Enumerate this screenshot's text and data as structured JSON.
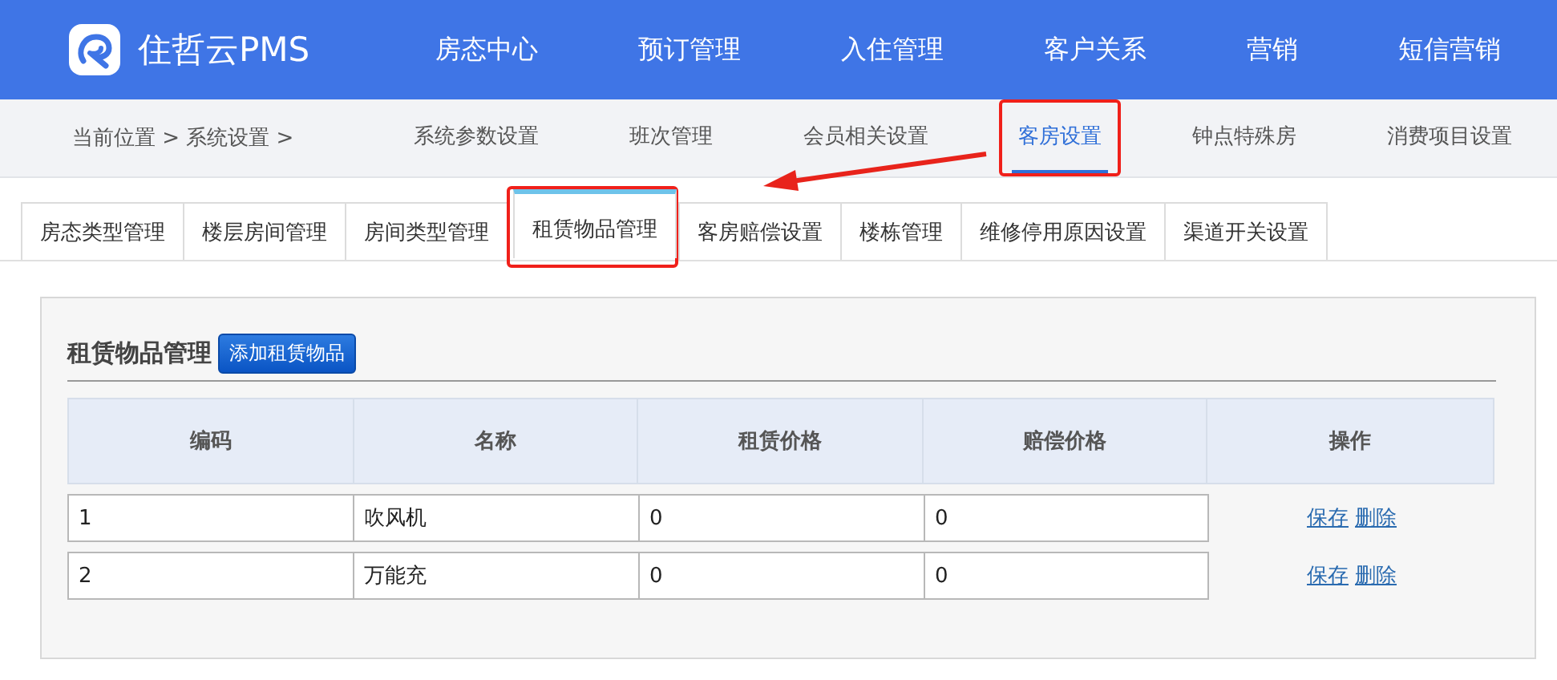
{
  "brand": {
    "name": "住哲云PMS"
  },
  "main_nav": [
    {
      "label": "房态中心",
      "selected": false
    },
    {
      "label": "预订管理",
      "selected": false
    },
    {
      "label": "入住管理",
      "selected": false
    },
    {
      "label": "客户关系",
      "selected": false
    },
    {
      "label": "营销",
      "selected": false
    },
    {
      "label": "短信营销",
      "selected": false
    }
  ],
  "breadcrumb": {
    "text": "当前位置 > 系统设置 >"
  },
  "sub_nav": [
    {
      "label": "系统参数设置",
      "selected": false,
      "annotated": false
    },
    {
      "label": "班次管理",
      "selected": false,
      "annotated": false
    },
    {
      "label": "会员相关设置",
      "selected": false,
      "annotated": false
    },
    {
      "label": "客房设置",
      "selected": true,
      "annotated": true
    },
    {
      "label": "钟点特殊房",
      "selected": false,
      "annotated": false
    },
    {
      "label": "消费项目设置",
      "selected": false,
      "annotated": false
    }
  ],
  "tabs": [
    {
      "label": "房态类型管理",
      "selected": false,
      "annotated": false
    },
    {
      "label": "楼层房间管理",
      "selected": false,
      "annotated": false
    },
    {
      "label": "房间类型管理",
      "selected": false,
      "annotated": false
    },
    {
      "label": "租赁物品管理",
      "selected": true,
      "annotated": true
    },
    {
      "label": "客房赔偿设置",
      "selected": false,
      "annotated": false
    },
    {
      "label": "楼栋管理",
      "selected": false,
      "annotated": false
    },
    {
      "label": "维修停用原因设置",
      "selected": false,
      "annotated": false
    },
    {
      "label": "渠道开关设置",
      "selected": false,
      "annotated": false
    }
  ],
  "annotation_arrow": true,
  "panel": {
    "title": "租赁物品管理",
    "add_button": "添加租赁物品"
  },
  "table": {
    "columns": [
      "编码",
      "名称",
      "租赁价格",
      "赔偿价格",
      "操作"
    ],
    "rows": [
      {
        "cells": [
          "1",
          "吹风机",
          "0",
          "0"
        ],
        "actions": [
          "保存",
          "删除"
        ]
      },
      {
        "cells": [
          "2",
          "万能充",
          "0",
          "0"
        ],
        "actions": [
          "保存",
          "删除"
        ]
      }
    ]
  }
}
